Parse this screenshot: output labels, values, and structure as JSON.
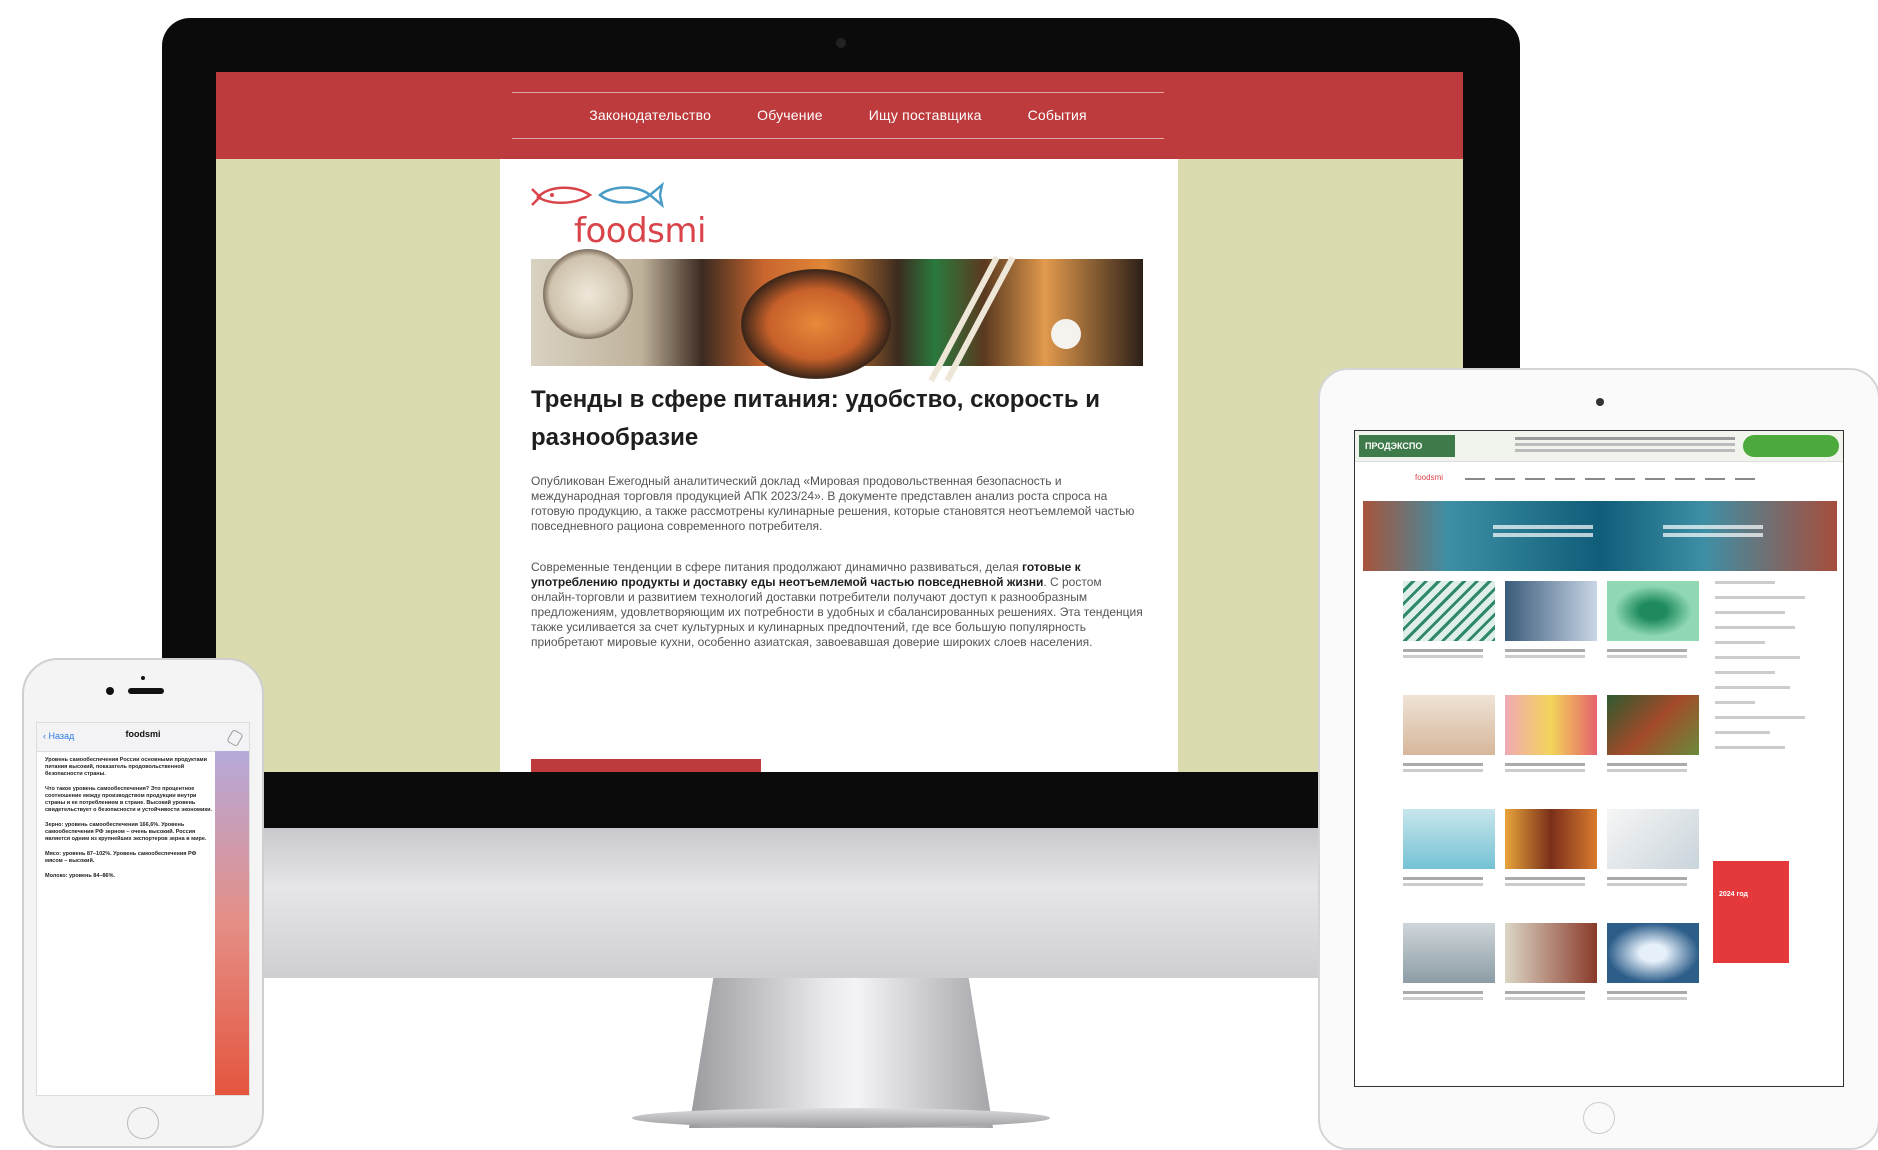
{
  "desktop": {
    "nav": [
      "Законодательство",
      "Обучение",
      "Ищу поставщика",
      "События"
    ],
    "logo_text": "foodsmi",
    "article": {
      "title": "Тренды в сфере питания: удобство, скорость и разнообразие",
      "para1": "Опубликован Ежегодный аналитический доклад «Мировая продовольственная безопасность и международная торговля продукцией АПК 2023/24». В документе представлен анализ роста спроса на готовую продукцию, а также рассмотрены кулинарные решения, которые становятся неотъемлемой частью повседневного рациона современного потребителя.",
      "para2_start": "Современные тенденции в сфере питания продолжают динамично развиваться, делая ",
      "para2_bold": "готовые к употреблению продукты и доставку еды неотъемлемой частью повседневной жизни",
      "para2_end": ". С ростом онлайн-торговли и развитием технологий доставки потребители получают доступ к разнообразным предложениям, удовлетворяющим их потребности в удобных и сбалансированных решениях. Эта тенденция также усиливается за счет культурных и кулинарных предпочтений, где все большую популярность приобретают мировые кухни, особенно азиатская, завоевавшая доверие широких слоев населения."
    }
  },
  "phone": {
    "back": "Назад",
    "channel": "foodsmi",
    "messages": [
      "Уровень самообеспечения России основными продуктами питания высокий, показатель продовольственной безопасности страны.",
      "Что такое уровень самообеспечения? Это процентное соотношение между производством продукции внутри страны и ее потреблением в стране. Высокий уровень свидетельствует о безопасности и устойчивости экономики.",
      "Зерно: уровень самообеспечения 166,6%. Уровень самообеспечения РФ зерном – очень высокий. Россия является одним из крупнейших экспортеров зерна в мире.",
      "Мясо: уровень 87–102%. Уровень самообеспечения РФ мясом – высокий.",
      "Молоко: уровень 84–86%."
    ]
  },
  "tablet": {
    "banner_logo": "ПРОДЭКСПО",
    "nav_logo": "foodsmi",
    "ad_title": "2024 год"
  },
  "colors": {
    "brand_red": "#bd3b3d",
    "page_bg": "#dadcb0",
    "logo_red": "#d9444a"
  }
}
